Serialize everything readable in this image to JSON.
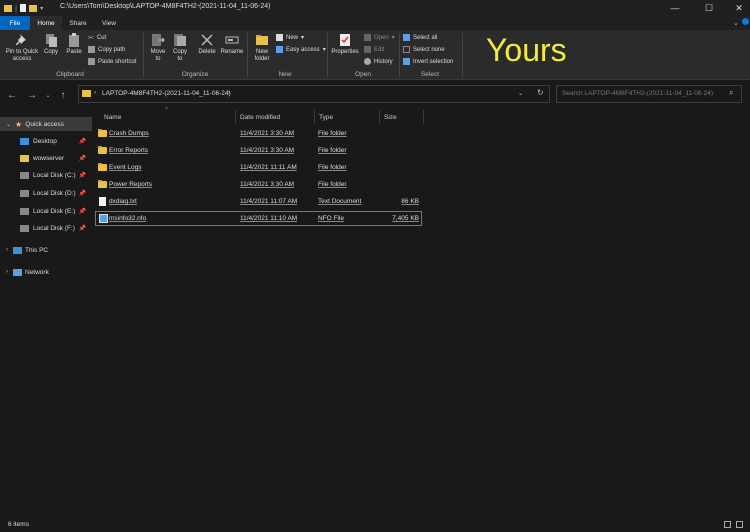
{
  "window": {
    "path": "C:\\Users\\Tom\\Desktop\\LAPTOP-4M8F4TH2-(2021-11-04_11-06-24)",
    "controls": [
      "—",
      "☐",
      "✕"
    ]
  },
  "tabs": [
    "File",
    "Home",
    "Share",
    "View"
  ],
  "ribbon": {
    "clipboard": {
      "pin": "Pin to Quick access",
      "copy": "Copy",
      "paste": "Paste",
      "cut": "Cut",
      "copy_path": "Copy path",
      "paste_shortcut": "Paste shortcut",
      "label": "Clipboard"
    },
    "organize": {
      "move_to": "Move to",
      "copy_to": "Copy to",
      "delete": "Delete",
      "rename": "Rename",
      "label": "Organize"
    },
    "new": {
      "new_folder": "New folder",
      "new_item": "New",
      "easy_access": "Easy access",
      "label": "New"
    },
    "open": {
      "properties": "Properties",
      "open": "Open",
      "edit": "Edit",
      "history": "History",
      "label": "Open"
    },
    "select": {
      "select_all": "Select all",
      "select_none": "Select none",
      "invert": "Invert selection",
      "label": "Select"
    },
    "overlay_text": "Yours"
  },
  "address": {
    "breadcrumb": "LAPTOP-4M8F4TH2-(2021-11-04_11-06-24)",
    "search_placeholder": "Search LAPTOP-4M8F4TH2-(2021-11-04_11-06-24)"
  },
  "nav": {
    "quick_access": "Quick access",
    "items": [
      "Desktop",
      "wowserver",
      "Local Disk (C:)",
      "Local Disk (D:)",
      "Local Disk (E:)",
      "Local Disk (F:)"
    ],
    "this_pc": "This PC",
    "network": "Network"
  },
  "columns": [
    "Name",
    "Date modified",
    "Type",
    "Size"
  ],
  "files": [
    {
      "name": "Crash Dumps",
      "date": "11/4/2021 3:30 AM",
      "type": "File folder",
      "size": "",
      "icon": "folder-icon"
    },
    {
      "name": "Error Reports",
      "date": "11/4/2021 3:30 AM",
      "type": "File folder",
      "size": "",
      "icon": "folder-icon"
    },
    {
      "name": "Event Logs",
      "date": "11/4/2021 11:11 AM",
      "type": "File folder",
      "size": "",
      "icon": "folder-icon"
    },
    {
      "name": "Power Reports",
      "date": "11/4/2021 3:30 AM",
      "type": "File folder",
      "size": "",
      "icon": "folder-icon"
    },
    {
      "name": "dxdiag.txt",
      "date": "11/4/2021 11:07 AM",
      "type": "Text Document",
      "size": "86 KB",
      "icon": "text-file-icon"
    },
    {
      "name": "msinfo32.nfo",
      "date": "11/4/2021 11:10 AM",
      "type": "NFO File",
      "size": "7,405 KB",
      "icon": "nfo-file-icon"
    }
  ],
  "status": "6 items",
  "colors": {
    "accent": "#0067c0",
    "overlay": "#f3ec3a",
    "folder": "#e9c04a"
  }
}
